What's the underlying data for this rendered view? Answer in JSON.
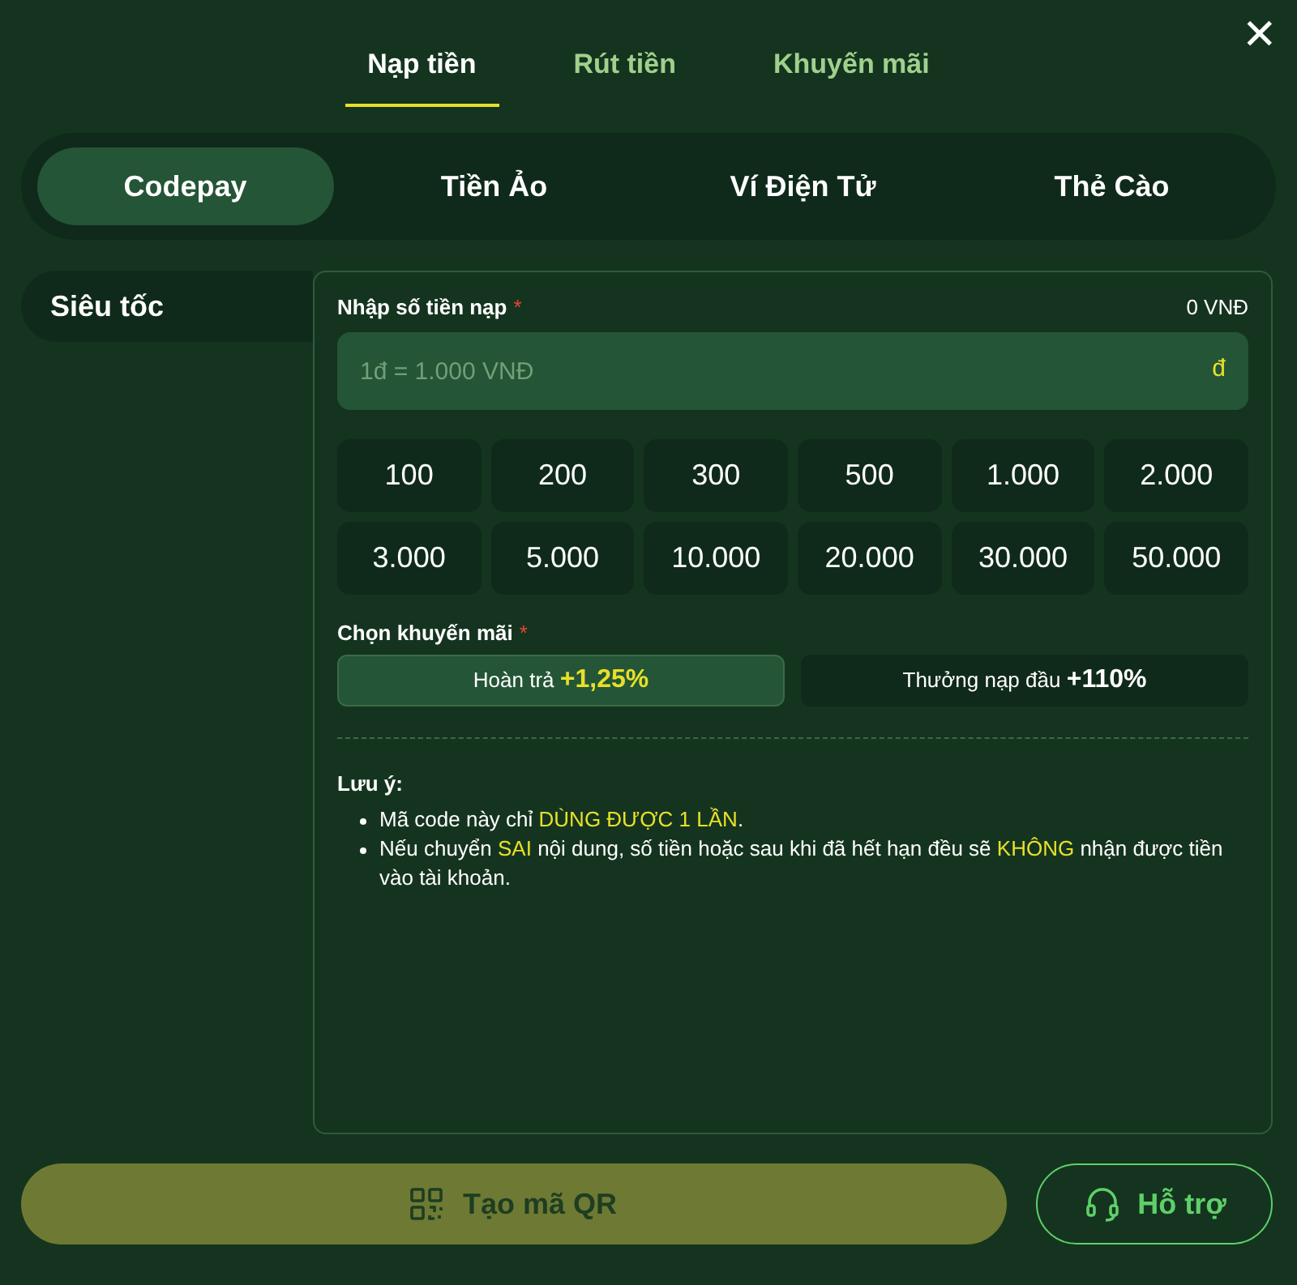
{
  "close_button": {
    "label": "✕"
  },
  "tabs": [
    {
      "label": "Nạp tiền",
      "selected": true
    },
    {
      "label": "Rút tiền",
      "selected": false
    },
    {
      "label": "Khuyến mãi",
      "selected": false
    }
  ],
  "methods": [
    {
      "label": "Codepay",
      "selected": true
    },
    {
      "label": "Tiền Ảo",
      "selected": false
    },
    {
      "label": "Ví Điện Tử",
      "selected": false
    },
    {
      "label": "Thẻ Cào",
      "selected": false
    }
  ],
  "sidebar": {
    "items": [
      {
        "label": "Siêu tốc"
      }
    ]
  },
  "amount": {
    "label": "Nhập số tiền nạp",
    "required_mark": "*",
    "total": "0 VNĐ",
    "placeholder": "1đ = 1.000 VNĐ",
    "suffix": "đ"
  },
  "amount_options": [
    "100",
    "200",
    "300",
    "500",
    "1.000",
    "2.000",
    "3.000",
    "5.000",
    "10.000",
    "20.000",
    "30.000",
    "50.000"
  ],
  "promotion": {
    "label": "Chọn khuyến mãi",
    "required_mark": "*",
    "options": [
      {
        "label": "Hoàn trả",
        "value": "+1,25%",
        "selected": true
      },
      {
        "label": "Thưởng nạp đầu",
        "value": "+110%",
        "selected": false
      }
    ]
  },
  "notes": {
    "title": "Lưu ý:",
    "items": [
      [
        {
          "text": "Mã code này chỉ ",
          "highlight": false
        },
        {
          "text": "DÙNG ĐƯỢC 1 LẦN",
          "highlight": true
        },
        {
          "text": ".",
          "highlight": false
        }
      ],
      [
        {
          "text": "Nếu chuyển ",
          "highlight": false
        },
        {
          "text": "SAI",
          "highlight": true
        },
        {
          "text": " nội dung, số tiền hoặc sau khi đã hết hạn đều sẽ ",
          "highlight": false
        },
        {
          "text": "KHÔNG",
          "highlight": true
        },
        {
          "text": " nhận được tiền vào tài khoản.",
          "highlight": false
        }
      ]
    ]
  },
  "buttons": {
    "primary": "Tạo mã QR",
    "support": "Hỗ trợ"
  }
}
